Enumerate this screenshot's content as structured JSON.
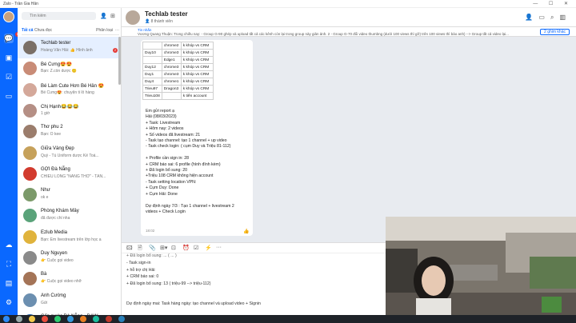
{
  "app": {
    "title": "Zalo - Trần Gia Hân",
    "window_controls": "— ☐ ✕"
  },
  "sidebar": {
    "chat_badge": "5"
  },
  "search": {
    "placeholder": "Tìm kiếm"
  },
  "tabs": {
    "all": "Tất cả",
    "unread": "Chưa đọc",
    "category": "Phân loại",
    "more": "···"
  },
  "conversations": [
    {
      "name": "Techlab tester",
      "msg": "Hoàng Văn Hải: 👍 Hình ảnh",
      "time": "",
      "badge": "2",
      "color": "#7a6f67"
    },
    {
      "name": "Bé Cưng😍😍",
      "msg": "Bạn: Z.còn dược 🙂",
      "time": "",
      "badge": "",
      "color": "#c98c77"
    },
    {
      "name": "Bé Làm Cute Hơn Bé Hân 😍",
      "msg": "Bé Cưng😍: chuyện ti lỗ hàng",
      "time": "",
      "badge": "",
      "color": "#d4a89a"
    },
    {
      "name": "Chị Hạnh😂😂😂",
      "msg": "1 giờ",
      "time": "",
      "badge": "",
      "color": "#b58f85"
    },
    {
      "name": "Thơ phu 2",
      "msg": "Bạn: Ô kee",
      "time": "",
      "badge": "",
      "color": "#9b7d6c"
    },
    {
      "name": "Giữa Vàng Đẹp",
      "msg": "Quý - Tú Uniform dược Kế Toá...",
      "time": "",
      "badge": "",
      "color": "#c6a15b"
    },
    {
      "name": "GỢI Đà Nẵng",
      "msg": "CHIỀU LÒNG \"NĂNG THƠ\" - TẤN...",
      "time": "",
      "badge": "",
      "color": "#d23b2e"
    },
    {
      "name": "Như",
      "msg": "ok e",
      "time": "",
      "badge": "",
      "color": "#7c9a6a"
    },
    {
      "name": "Phòng Khám Mây",
      "msg": "đã được chỉ nha",
      "time": "",
      "badge": "",
      "color": "#5aa37a"
    },
    {
      "name": "Ezlub Media",
      "msg": "Bạn: Em livestream trên lớp học a",
      "time": "",
      "badge": "",
      "color": "#e0b33c"
    },
    {
      "name": "Duy Nguyen",
      "msg": "👉 Cuộc gọi video",
      "time": "",
      "badge": "",
      "color": "#8a8a8a"
    },
    {
      "name": "Bà",
      "msg": "👉 Cuộc gọi video nhỡ",
      "time": "",
      "badge": "",
      "color": "#a47457"
    },
    {
      "name": "Anh Cường",
      "msg": "Gửi",
      "time": "",
      "badge": "",
      "color": "#6c8fb0"
    },
    {
      "name": "Cấp nước Đà Nẵng - DAW...",
      "msg": "THÀNH TOÁN THÀNH CÔNG",
      "time": "",
      "badge": "",
      "color": "#2b6cb0"
    }
  ],
  "chat": {
    "group_name": "Techlab tester",
    "members": "👤 8 thành viên",
    "pinned_label": "Tin nhắn",
    "pinned_text": "Vương Quang Thuận: Trong chiều nay: - Group G-90 ghép và upload tất cả các kênh còn lại trong group này giản ảnh. 2 - Group G-70 đổi video thumbng (dưới 100 views thì gỡ) trên 100 views thì báo anh) --> Group tất cả video lại...",
    "pinned_button": "2 ghim khác",
    "table_rows": [
      [
        "",
        "chrome2",
        "k khóp vs CRM"
      ],
      [
        "Duy10",
        "chrome3",
        "k khóp vs CRM"
      ],
      [
        "",
        "Edge1",
        "k khóp vs CRM"
      ],
      [
        "Duy12",
        "chrome3",
        "k khóp vs CRM"
      ],
      [
        "Duy1",
        "chrome3",
        "k khóp vs CRM"
      ],
      [
        "Duy4",
        "chrome1",
        "k khóp vs CRM"
      ],
      [
        "Trieu97",
        "Dragon3",
        "k khóp vs CRM"
      ],
      [
        "Trieu108",
        "",
        "k tiến account"
      ]
    ],
    "report_lines": [
      "Em gửi report ạ",
      "Hải (08/03/2023)",
      "+ Task: Livestream",
      "+ Hôm nay: 2 videos",
      "+ Số videos đã livestream: 21",
      "- Task tạo channel: tạo 1 channel + up video",
      "- Task check login: ( cụm Duy và Triệu 81-112)",
      "",
      "+ Profile cần sign in: 28",
      "+ CRM báo sai: 6 profile (hình đính kèm)",
      "+ Đã login bổ sung: 20",
      "+Triệu 108 CRM không hiện account",
      "- Task setting location VPN:",
      "+ Cụm Duy: Done",
      "+ Cụm Hải: Done",
      "",
      "Dự định ngày 7/3 : Tạo 1 channel + livestream 2",
      "videos + Check Login"
    ],
    "message_time": "18:02"
  },
  "toolbar": [
    "🖾",
    "🗎",
    "📎",
    "⊞▾",
    "⊡",
    "⏰",
    "☑",
    "⚡",
    "···"
  ],
  "editor_lines": [
    "- Task sign-in",
    "+ hỗ trợ chị Hải",
    "+ CRM báo sai: 0",
    "+ Đã login bổ sung: 13 ( triệu-99 --> triệu-112)",
    "",
    "Dự định ngày mai: Task hàng ngày: tạo channel và upload video + Signin"
  ],
  "editor_top_partial": "+ Đã login bổ sung: ... ( ... )"
}
